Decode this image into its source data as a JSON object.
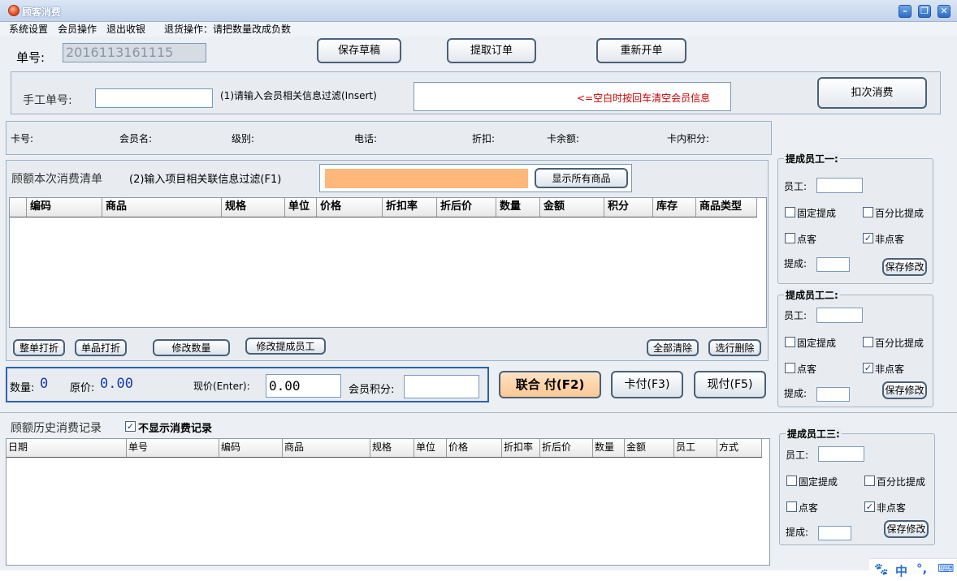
{
  "window": {
    "title": "顾客消费"
  },
  "menu": [
    "系统设置",
    "会员操作",
    "退出收银",
    "退货操作：请把数量改成负数"
  ],
  "top": {
    "order_label": "单号:",
    "order_no": "2016113161115",
    "save_draft": "保存草稿",
    "fetch_order": "提取订单",
    "new_order": "重新开单"
  },
  "member_filter": {
    "manual_label": "手工单号:",
    "filter_label": "(1)请输入会员相关信息过滤(Insert)",
    "hint": "<=空白时按回车清空会员信息",
    "deduct_button": "扣次消费"
  },
  "member_info": {
    "card": "卡号:",
    "name": "会员名:",
    "level": "级别:",
    "phone": "电话:",
    "discount": "折扣:",
    "balance": "卡余额:",
    "points": "卡内积分:"
  },
  "items": {
    "section_title": "顾额本次消费清单",
    "filter_label": "(2)输入项目相关联信息过滤(F1)",
    "show_all": "显示所有商品",
    "columns": [
      "编码",
      "商品",
      "规格",
      "单位",
      "价格",
      "折扣率",
      "折后价",
      "数量",
      "金额",
      "积分",
      "库存",
      "商品类型"
    ],
    "buttons": {
      "whole_discount": "整单打折",
      "single_discount": "单品打折",
      "edit_qty": "修改数量",
      "edit_staff": "修改提成员工",
      "clear_all": "全部清除",
      "delete_selected": "选行删除"
    }
  },
  "summary": {
    "qty_label": "数量:",
    "qty": "0",
    "orig_label": "原价:",
    "orig": "0.00",
    "now_label": "现价(Enter):",
    "now": "0.00",
    "points_label": "会员积分:",
    "combined_pay": "联合 付(F2)",
    "card_pay": "卡付(F3)",
    "cash_pay": "现付(F5)"
  },
  "history": {
    "title": "顾额历史消费记录",
    "hide_label": "不显示消费记录",
    "columns": [
      "日期",
      "单号",
      "编码",
      "商品",
      "规格",
      "单位",
      "价格",
      "折扣率",
      "折后价",
      "数量",
      "金额",
      "员工",
      "方式"
    ]
  },
  "staff_groups": [
    {
      "title": "提成员工一:",
      "staff_label": "员工:",
      "fixed": "固定提成",
      "percent": "百分比提成",
      "dian": "点客",
      "fei": "非点客",
      "comm_label": "提成:",
      "save": "保存修改"
    },
    {
      "title": "提成员工二:",
      "staff_label": "员工:",
      "fixed": "固定提成",
      "percent": "百分比提成",
      "dian": "点客",
      "fei": "非点客",
      "comm_label": "提成:",
      "save": "保存修改"
    },
    {
      "title": "提成员工三:",
      "staff_label": "员工:",
      "fixed": "固定提成",
      "percent": "百分比提成",
      "dian": "点客",
      "fei": "非点客",
      "comm_label": "提成:",
      "save": "保存修改"
    }
  ],
  "ime": {
    "lang": "中",
    "punct": "°,"
  }
}
